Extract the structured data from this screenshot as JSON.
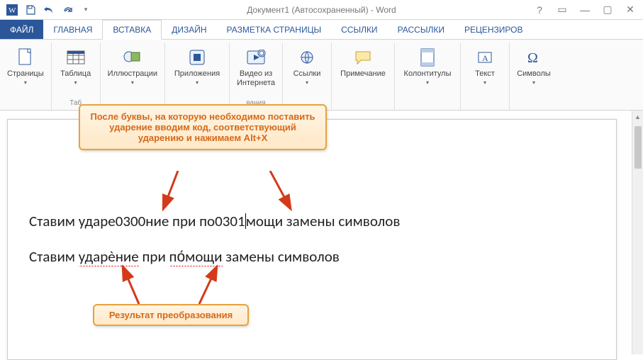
{
  "title": "Документ1 (Автосохраненный) - Word",
  "qat": {
    "save": "save-icon",
    "undo": "undo-icon",
    "redo": "redo-icon",
    "customize": "customize-qat-icon"
  },
  "window_controls": [
    "?",
    "▭",
    "—",
    "▢",
    "✕"
  ],
  "tabs": {
    "file": "ФАЙЛ",
    "home": "ГЛАВНАЯ",
    "insert": "ВСТАВКА",
    "design": "ДИЗАЙН",
    "layout": "РАЗМЕТКА СТРАНИЦЫ",
    "references": "ССЫЛКИ",
    "mailings": "РАССЫЛКИ",
    "review": "РЕЦЕНЗИРОВ"
  },
  "ribbon": {
    "pages": {
      "label": "Страницы"
    },
    "tables": {
      "btn": "Таблица",
      "label": "Таб"
    },
    "illustrations": {
      "btn": "Иллюстрации"
    },
    "apps": {
      "btn": "Приложения"
    },
    "video": {
      "btn": "Видео из\nИнтернета",
      "label": "вания"
    },
    "links": {
      "btn": "Ссылки"
    },
    "comment": {
      "btn": "Примечание"
    },
    "headerfooter": {
      "btn": "Колонтитулы"
    },
    "text": {
      "btn": "Текст"
    },
    "symbols": {
      "btn": "Символы"
    }
  },
  "callouts": {
    "top": "После буквы, на которую необходимо поставить ударение вводим код, соответствующий ударению и нажимаем Alt+X",
    "bottom": "Результат преобразования"
  },
  "document": {
    "line1_a": "Ставим ударе0300ние при по0301",
    "line1_b": "мощи замены символов",
    "line2_a": "Ставим ",
    "line2_b": "ударѐние",
    "line2_c": " при ",
    "line2_d": "по́мощи",
    "line2_e": " замены символов"
  }
}
